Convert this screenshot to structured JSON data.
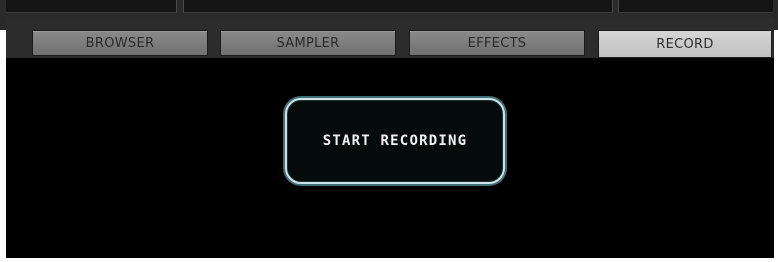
{
  "tabs": [
    {
      "label": "BROWSER",
      "active": false
    },
    {
      "label": "SAMPLER",
      "active": false
    },
    {
      "label": "EFFECTS",
      "active": false
    },
    {
      "label": "RECORD",
      "active": true
    }
  ],
  "record_panel": {
    "start_button_label": "START RECORDING"
  },
  "colors": {
    "panel_background": "#000000",
    "tab_inactive": "#7c7c7c",
    "tab_active": "#cbcbcb",
    "button_border": "#cfe3e6",
    "button_glow": "#3f6f74"
  }
}
